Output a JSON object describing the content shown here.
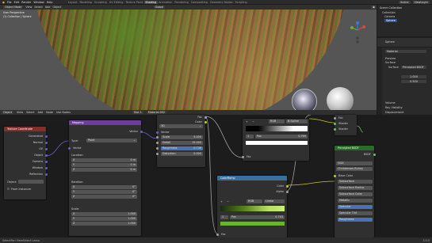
{
  "menu": [
    "File",
    "Edit",
    "Render",
    "Window",
    "Help"
  ],
  "workspaces": [
    "Layout",
    "Modeling",
    "Sculpting",
    "UV Editing",
    "Texture Paint",
    "Shading",
    "Animation",
    "Rendering",
    "Compositing",
    "Geometry Nodes",
    "Scripting"
  ],
  "active_workspace": "Shading",
  "scene": {
    "label": "Scene",
    "view_layer": "ViewLayer"
  },
  "viewport": {
    "mode": "Object Mode",
    "menus": [
      "View",
      "Select",
      "Add",
      "Object"
    ],
    "shading": "Global",
    "overlay_text": "User Perspective",
    "collection_text": "(1) Collection | Sphere"
  },
  "outliner": {
    "title": "Scene Collection",
    "items": [
      "Collection",
      "Camera",
      "Sphere"
    ]
  },
  "properties": {
    "object": "Sphere",
    "material": "Material",
    "preview": "Preview",
    "surface": "Surface",
    "surface_shader": "Principled BSDF",
    "volume": "Volume",
    "settings": "Settings",
    "line_art": "Line Art",
    "viewport_display": "Viewport Display",
    "custom_props": "Custom Properties",
    "rows": [
      "Ray Visibility",
      "Volume",
      "Displacement"
    ],
    "val1": "1.000",
    "val2": "0.500"
  },
  "node_editor": {
    "object": "Object",
    "menus": [
      "View",
      "Select",
      "Add",
      "Node"
    ],
    "use_nodes": "Use Nodes",
    "slot": "Slot 1",
    "material": "Material.002"
  },
  "nodes": {
    "texcoord": {
      "title": "Texture Coordinate",
      "outputs": [
        "Generated",
        "Normal",
        "UV",
        "Object",
        "Camera",
        "Window",
        "Reflection"
      ],
      "object_label": "Object:",
      "from_instancer": "From Instancer"
    },
    "mapping": {
      "title": "Mapping",
      "vector_out": "Vector",
      "type_label": "Type:",
      "type_value": "Point",
      "vector_in": "Vector",
      "location": "Location:",
      "rotation": "Rotation:",
      "scale": "Scale:",
      "loc": [
        "0 m",
        "0 m",
        "0 m"
      ],
      "rot": [
        "0°",
        "0°",
        "0°"
      ],
      "scl": [
        "1.000",
        "1.000",
        "1.000"
      ],
      "axes": [
        "X",
        "Y",
        "Z"
      ]
    },
    "noise": {
      "title": "Noise Texture",
      "fac": "Fac",
      "color": "Color",
      "dim": "3D",
      "vector": "Vector",
      "scale_label": "Scale",
      "scale": "5.000",
      "detail_label": "Detail",
      "detail": "15.000",
      "roughness_label": "Roughness",
      "roughness": "0.736",
      "distortion_label": "Distortion",
      "distortion": "0.000"
    },
    "ramp1": {
      "title": "ColorRamp",
      "color": "Color",
      "alpha": "Alpha",
      "mode": "RGB",
      "interp": "B-Spline",
      "pos_label": "Pos",
      "pos": "0.769",
      "fac": "Fac",
      "idx": "1"
    },
    "ramp2": {
      "title": "ColorRamp",
      "color": "Color",
      "alpha": "Alpha",
      "mode": "RGB",
      "interp": "Linear",
      "pos_label": "Pos",
      "pos": "0.743",
      "fac": "Fac",
      "idx": "1"
    },
    "principled": {
      "title": "Principled BSDF",
      "bsdf": "BSDF",
      "ggx": "GGX",
      "burley": "Christensen-Burley",
      "base": "Base Color",
      "sss": "Subsurface",
      "sss_r": "Subsurface Radius",
      "sss_c": "Subsurface Color",
      "metallic": "Metallic",
      "specular": "Specular",
      "spec_tint": "Specular Tint",
      "roughness": "Roughness"
    },
    "mix": {
      "fac": "Fac",
      "shader1": "Shader",
      "shader2": "Shader",
      "shader_out": "Shader"
    }
  },
  "statusbar": {
    "left": "Select",
    "mid": "Pan View",
    "right": "Select Lasso",
    "version": "3.0.0"
  },
  "colors": {
    "accent": "#4772b3",
    "texcoord_head": "#862d2d",
    "mapping_head": "#6b3e9e",
    "noise_head": "#863a2b",
    "ramp_head": "#3b6f9e",
    "bsdf_head": "#2a6b2a"
  }
}
